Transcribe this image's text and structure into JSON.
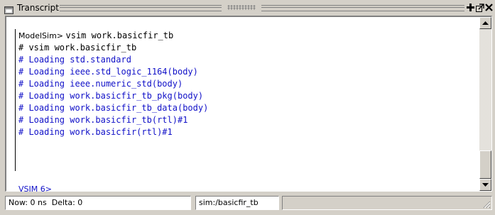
{
  "window": {
    "title": "Transcript",
    "icon": "transcript-window-icon"
  },
  "titlebar_buttons": [
    {
      "name": "add-pane-icon",
      "glyph": "+"
    },
    {
      "name": "undock-icon",
      "glyph": "undock"
    },
    {
      "name": "close-icon",
      "glyph": "x"
    }
  ],
  "transcript": {
    "first_line": {
      "prompt": "ModelSim> ",
      "command": "vsim work.basicfir_tb"
    },
    "lines": [
      {
        "kind": "echo",
        "text": "# vsim work.basicfir_tb"
      },
      {
        "kind": "load",
        "text": "# Loading std.standard"
      },
      {
        "kind": "load",
        "text": "# Loading ieee.std_logic_1164(body)"
      },
      {
        "kind": "load",
        "text": "# Loading ieee.numeric_std(body)"
      },
      {
        "kind": "load",
        "text": "# Loading work.basicfir_tb_pkg(body)"
      },
      {
        "kind": "load",
        "text": "# Loading work.basicfir_tb_data(body)"
      },
      {
        "kind": "load",
        "text": "# Loading work.basicfir_tb(rtl)#1"
      },
      {
        "kind": "load",
        "text": "# Loading work.basicfir(rtl)#1"
      }
    ],
    "current_prompt": "VSIM 6>"
  },
  "status_bar": {
    "time": "Now: 0 ns  Delta: 0",
    "context": "sim:/basicfir_tb",
    "extra": ""
  },
  "colors": {
    "command_text": "#000000",
    "load_text": "#1010c8",
    "chrome": "#d4d0c8"
  }
}
